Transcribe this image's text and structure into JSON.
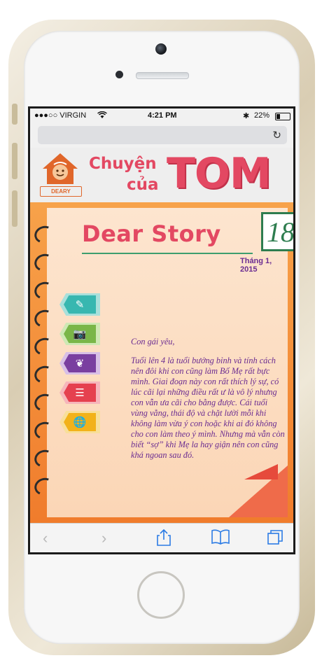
{
  "status_bar": {
    "carrier": "●●●○○ VIRGIN",
    "time": "4:21 PM",
    "battery": "22%"
  },
  "browser": {
    "reload_icon": "reload-icon"
  },
  "site": {
    "logo_text": "DEARY",
    "title_line1": "Chuyện",
    "title_line2": "của",
    "title_big": "TOM"
  },
  "story": {
    "heading": "Dear Story",
    "issue_number": "18",
    "date": "Tháng 1, 2015",
    "greeting": "Con gái yêu,",
    "body": "Tuổi lên 4 là tuổi bướng bỉnh và tính cách nên đôi khi con cũng làm Bố Mẹ rất bực mình. Giai đoạn này con rất thích lý sự, có lúc cãi lại những điều rất ư là vô lý nhưng con vẫn ưa cãi cho bằng được. Cái tuổi vùng vằng, thái độ và chặt lười mỗi khi không làm vừa ý con hoặc khi ai đó không cho con làm theo ý mình. Nhưng mà vẫn còn biết “sợ” khi Mẹ la hay giận nên con cũng khá ngoan sau đó."
  },
  "tabs": [
    {
      "icon": "edit-icon",
      "color": "#38b7b0"
    },
    {
      "icon": "camera-icon",
      "color": "#7ab648"
    },
    {
      "icon": "laurel-icon",
      "color": "#7a3fa0"
    },
    {
      "icon": "clipboard-icon",
      "color": "#e5404f"
    },
    {
      "icon": "globe-icon",
      "color": "#f2b21a"
    }
  ],
  "colors": {
    "brand_pink": "#e34862",
    "text_purple": "#6b2c91",
    "notebook_orange": "#f07c2c",
    "ios_blue": "#2b7be4"
  }
}
